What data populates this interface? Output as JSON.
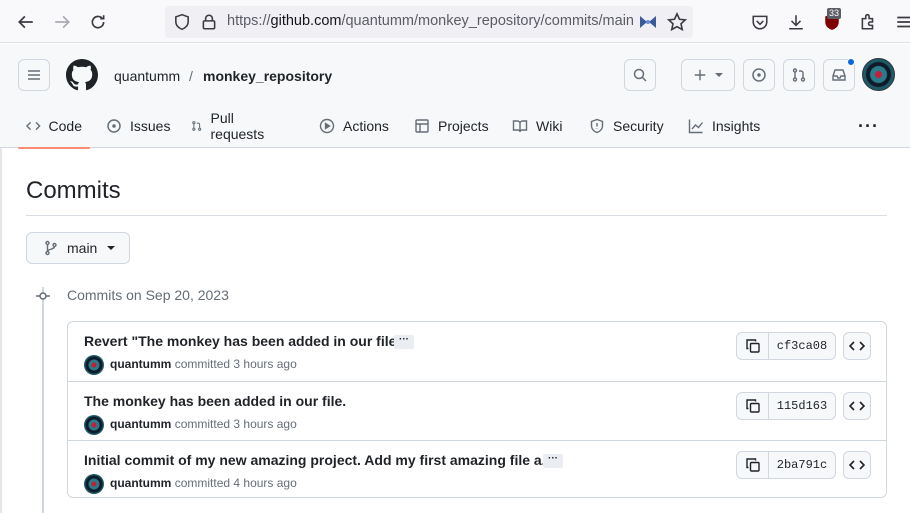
{
  "browser": {
    "url_prefix": "https://",
    "url_host": "github.com",
    "url_path": "/quantumm/monkey_repository/commits/main",
    "extension_badge": "33"
  },
  "repo": {
    "owner": "quantumm",
    "separator": "/",
    "name": "monkey_repository"
  },
  "tabs": [
    {
      "label": "Code",
      "icon": "code-icon",
      "selected": true
    },
    {
      "label": "Issues",
      "icon": "issue-opened-icon",
      "selected": false
    },
    {
      "label": "Pull requests",
      "icon": "git-pull-request-icon",
      "selected": false
    },
    {
      "label": "Actions",
      "icon": "play-icon",
      "selected": false
    },
    {
      "label": "Projects",
      "icon": "table-icon",
      "selected": false
    },
    {
      "label": "Wiki",
      "icon": "book-icon",
      "selected": false
    },
    {
      "label": "Security",
      "icon": "shield-icon",
      "selected": false
    },
    {
      "label": "Insights",
      "icon": "graph-icon",
      "selected": false
    }
  ],
  "page": {
    "title": "Commits",
    "branch": "main"
  },
  "commit_group": {
    "label": "Commits on Sep 20, 2023",
    "commits": [
      {
        "message": "Revert \"The monkey has been added in our file.\"",
        "has_more": true,
        "author": "quantumm",
        "verb": "committed",
        "time": "3 hours ago",
        "sha": "cf3ca08"
      },
      {
        "message": "The monkey has been added in our file.",
        "has_more": false,
        "author": "quantumm",
        "verb": "committed",
        "time": "3 hours ago",
        "sha": "115d163"
      },
      {
        "message": "Initial commit of my new amazing project. Add my first amazing file a...",
        "has_more": true,
        "author": "quantumm",
        "verb": "committed",
        "time": "4 hours ago",
        "sha": "2ba791c"
      }
    ]
  },
  "colors": {
    "tab_underline": "#fd8c73",
    "border": "#d0d7de",
    "muted_text": "#656d76",
    "notification_dot": "#0969da"
  }
}
